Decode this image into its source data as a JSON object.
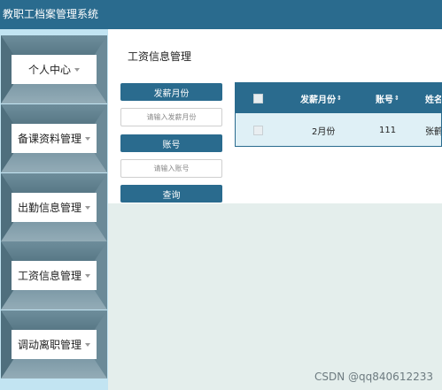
{
  "header": {
    "title": "教职工档案管理系统"
  },
  "sidebar": {
    "items": [
      {
        "label": "个人中心"
      },
      {
        "label": "备课资料管理"
      },
      {
        "label": "出勤信息管理"
      },
      {
        "label": "工资信息管理"
      },
      {
        "label": "调动离职管理"
      }
    ]
  },
  "main": {
    "page_title": "工资信息管理",
    "filters": {
      "month_label": "发薪月份",
      "month_placeholder": "请输入发薪月份",
      "account_label": "账号",
      "account_placeholder": "请输入账号",
      "search_label": "查询"
    },
    "table": {
      "columns": [
        "发薪月份",
        "账号",
        "姓名"
      ],
      "rows": [
        [
          "2月份",
          "111",
          "张鹤"
        ]
      ]
    }
  },
  "watermark": "CSDN @qq840612233",
  "colors": {
    "primary": "#2a6b8e",
    "sidebar": "#c2e4f2",
    "background": "#e4eeec"
  }
}
